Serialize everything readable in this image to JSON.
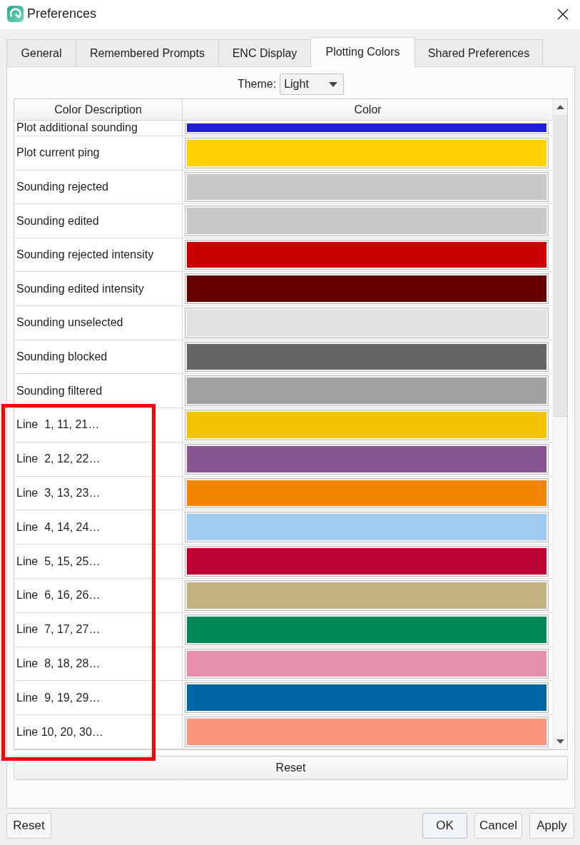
{
  "window": {
    "title": "Preferences"
  },
  "tabs": [
    {
      "label": "General",
      "selected": false
    },
    {
      "label": "Remembered Prompts",
      "selected": false
    },
    {
      "label": "ENC Display",
      "selected": false
    },
    {
      "label": "Plotting Colors",
      "selected": true
    },
    {
      "label": "Shared Preferences",
      "selected": false
    }
  ],
  "theme": {
    "label": "Theme:",
    "value": "Light"
  },
  "table": {
    "columns": [
      "Color Description",
      "Color"
    ],
    "rows": [
      {
        "description": "Plot additional sounding",
        "color": "#2020cc",
        "cut_off": true
      },
      {
        "description": "Plot current ping",
        "color": "#ffd200",
        "cut_off": false
      },
      {
        "description": "Sounding rejected",
        "color": "#c8c8c8",
        "cut_off": false
      },
      {
        "description": "Sounding edited",
        "color": "#c8c8c8",
        "cut_off": false
      },
      {
        "description": "Sounding rejected intensity",
        "color": "#c80000",
        "cut_off": false
      },
      {
        "description": "Sounding edited intensity",
        "color": "#640000",
        "cut_off": false
      },
      {
        "description": "Sounding unselected",
        "color": "#e1e1e1",
        "cut_off": false
      },
      {
        "description": "Sounding blocked",
        "color": "#646464",
        "cut_off": false
      },
      {
        "description": "Sounding filtered",
        "color": "#a0a0a0",
        "cut_off": false
      }
    ],
    "highlighted_rows": [
      {
        "description": "Line  1, 11, 21…",
        "color": "#f2c300"
      },
      {
        "description": "Line  2, 12, 22…",
        "color": "#875692"
      },
      {
        "description": "Line  3, 13, 23…",
        "color": "#f38400"
      },
      {
        "description": "Line  4, 14, 24…",
        "color": "#a1caf1"
      },
      {
        "description": "Line  5, 15, 25…",
        "color": "#be0032"
      },
      {
        "description": "Line  6, 16, 26…",
        "color": "#c2b280"
      },
      {
        "description": "Line  7, 17, 27…",
        "color": "#008856"
      },
      {
        "description": "Line  8, 18, 28…",
        "color": "#e68fac"
      },
      {
        "description": "Line  9, 19, 29…",
        "color": "#0067a5"
      },
      {
        "description": "Line 10, 20, 30…",
        "color": "#f99379"
      }
    ]
  },
  "reset_button": "Reset",
  "footer": {
    "left_buttons": [
      {
        "label": "Reset",
        "default": false
      }
    ],
    "right_buttons": [
      {
        "label": "OK",
        "default": true
      },
      {
        "label": "Cancel",
        "default": false
      },
      {
        "label": "Apply",
        "default": false
      }
    ]
  }
}
